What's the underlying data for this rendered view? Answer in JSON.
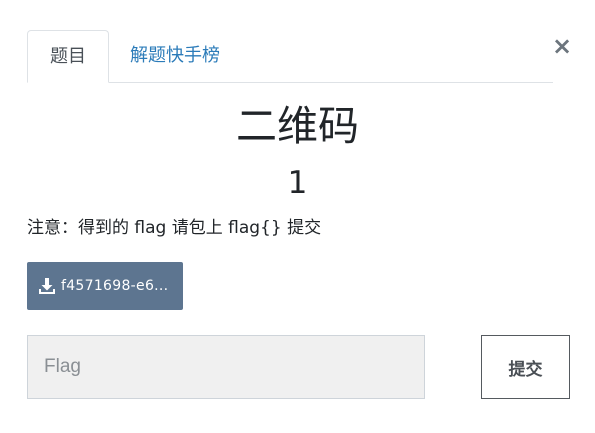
{
  "tabs": [
    {
      "label": "题目",
      "active": true
    },
    {
      "label": "解题快手榜",
      "active": false
    }
  ],
  "close": {
    "glyph": "×",
    "icon": "close-icon"
  },
  "challenge": {
    "name": "二维码",
    "value": "1",
    "description": "注意：得到的 flag 请包上 flag{} 提交"
  },
  "download": {
    "icon": "download-icon",
    "label": "f4571698-e6..."
  },
  "submission": {
    "input_value": "",
    "placeholder": "Flag",
    "submit_label": "提交"
  },
  "colors": {
    "tab_link": "#2b7bb9",
    "download_bg": "#5d7590",
    "input_bg": "#f0f0f0"
  }
}
